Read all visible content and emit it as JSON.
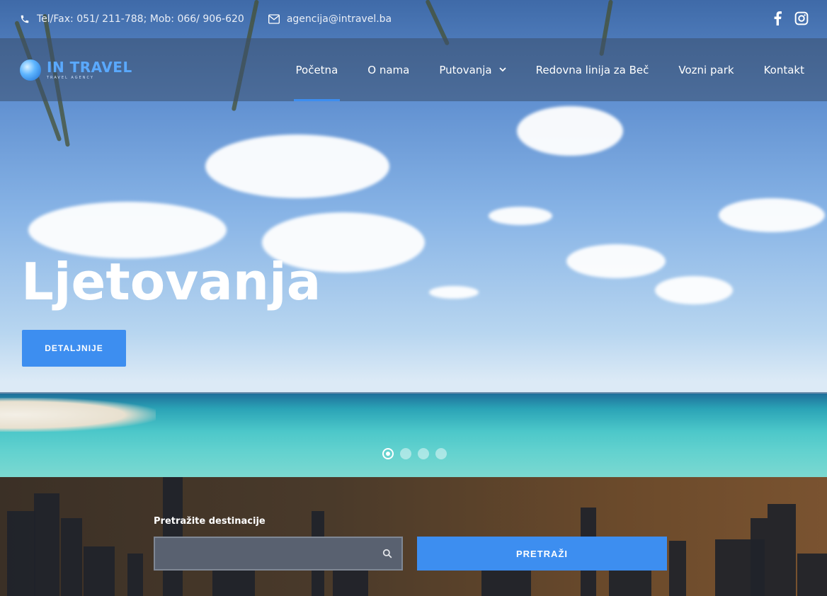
{
  "topbar": {
    "phone_text": "Tel/Fax: 051/ 211-788; Mob: 066/ 906-620",
    "email_text": "agencija@intravel.ba",
    "social": [
      {
        "icon": "facebook-icon"
      },
      {
        "icon": "instagram-icon"
      }
    ]
  },
  "logo": {
    "name": "IN TRAVEL",
    "tagline": "TRAVEL AGENCY"
  },
  "nav": {
    "items": [
      {
        "label": "Početna",
        "active": true
      },
      {
        "label": "O nama"
      },
      {
        "label": "Putovanja",
        "has_dropdown": true
      },
      {
        "label": "Redovna linija za Beč"
      },
      {
        "label": "Vozni park"
      },
      {
        "label": "Kontakt"
      }
    ]
  },
  "hero": {
    "title": "Ljetovanja",
    "button_label": "DETALJNIJE",
    "slides_total": 4,
    "active_slide": 1
  },
  "search": {
    "label": "Pretražite destinacije",
    "placeholder": "",
    "button_label": "PRETRAŽI"
  },
  "colors": {
    "accent": "#3d8ef0"
  }
}
